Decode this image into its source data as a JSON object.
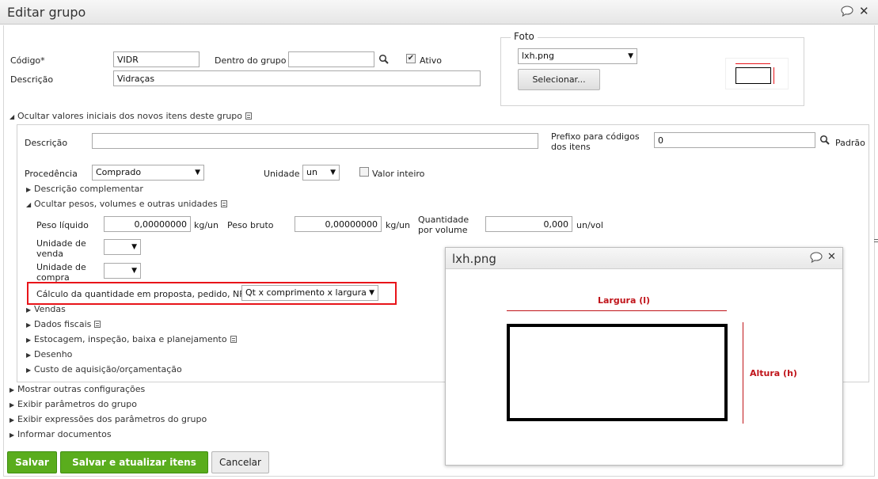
{
  "window": {
    "title": "Editar grupo"
  },
  "group": {
    "codigo_label": "Código*",
    "codigo_value": "VIDR",
    "dentro_label": "Dentro do grupo",
    "dentro_value": "",
    "ativo_label": "Ativo",
    "ativo_checked": true,
    "descricao_label": "Descrição",
    "descricao_value": "Vidraças"
  },
  "foto": {
    "legend": "Foto",
    "selected_file": "lxh.png",
    "select_button": "Selecionar..."
  },
  "initial_values": {
    "toggle_label": "Ocultar valores iniciais dos novos itens deste grupo",
    "descricao_label": "Descrição",
    "descricao_value": "",
    "prefixo_label_line1": "Prefixo para códigos",
    "prefixo_label_line2": "dos itens",
    "prefixo_value": "0",
    "padrao_label": "Padrão",
    "procedencia_label": "Procedência",
    "procedencia_value": "Comprado",
    "unidade_label": "Unidade",
    "unidade_value": "un",
    "valor_inteiro_label": "Valor inteiro",
    "descricao_complementar": "Descrição complementar",
    "pesos_toggle": "Ocultar pesos, volumes e outras unidades",
    "peso_liquido_label": "Peso líquido",
    "peso_liquido_value": "0,00000000",
    "peso_liquido_unit": "kg/un",
    "peso_bruto_label": "Peso bruto",
    "peso_bruto_value": "0,00000000",
    "peso_bruto_unit": "kg/un",
    "qtd_volume_label_line1": "Quantidade",
    "qtd_volume_label_line2": "por volume",
    "qtd_volume_value": "0,000",
    "qtd_volume_unit": "un/vol",
    "unidade_venda_line1": "Unidade de",
    "unidade_venda_line2": "venda",
    "unidade_compra_line1": "Unidade de",
    "unidade_compra_line2": "compra",
    "calculo_label": "Cálculo da quantidade em proposta, pedido, NF",
    "calculo_value": "Qt x comprimento x largura",
    "sections": [
      "Vendas",
      "Dados fiscais",
      "Estocagem, inspeção, baixa e planejamento",
      "Desenho",
      "Custo de aquisição/orçamentação"
    ]
  },
  "outer_sections": [
    "Mostrar outras configurações",
    "Exibir parâmetros do grupo",
    "Exibir expressões dos parâmetros do grupo",
    "Informar documentos"
  ],
  "buttons": {
    "save": "Salvar",
    "save_update": "Salvar e atualizar itens",
    "cancel": "Cancelar"
  },
  "preview": {
    "title": "lxh.png",
    "width_label": "Largura (l)",
    "height_label": "Altura (h)"
  },
  "colors": {
    "highlight_red": "#e8141a",
    "green_button": "#5aad1d",
    "title_bar": "#eeeeee"
  }
}
